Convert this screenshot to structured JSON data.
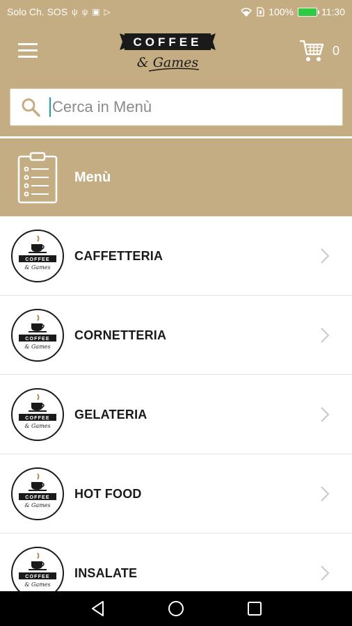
{
  "status_bar": {
    "carrier": "Solo Ch. SOS",
    "battery": "100%",
    "time": "11:30"
  },
  "header": {
    "logo_top": "COFFEE",
    "logo_bottom": "& Games",
    "cart_count": "0"
  },
  "search": {
    "placeholder": "Cerca in Menù"
  },
  "banner": {
    "title": "Menù"
  },
  "categories": [
    {
      "label": "CAFFETTERIA"
    },
    {
      "label": "CORNETTERIA"
    },
    {
      "label": "GELATERIA"
    },
    {
      "label": "HOT FOOD"
    },
    {
      "label": "INSALATE"
    }
  ],
  "colors": {
    "brand": "#c4ad82",
    "text": "#1a1a1a",
    "accent_caret": "#1a9ea8"
  }
}
